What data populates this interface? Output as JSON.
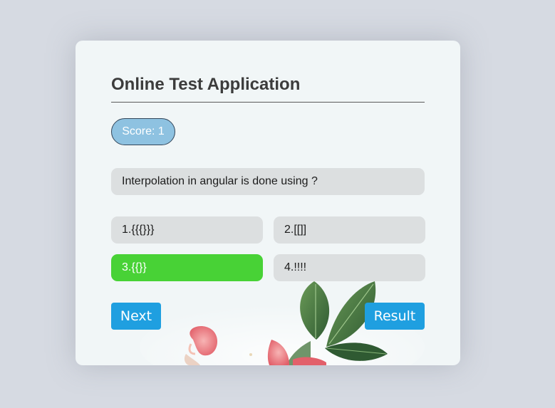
{
  "app": {
    "title": "Online Test Application"
  },
  "score": {
    "label": "Score: 1"
  },
  "question": {
    "text": "Interpolation in angular is done using ?"
  },
  "options": [
    {
      "label": "1.{{{}}}",
      "state": "default"
    },
    {
      "label": "2.[[]]",
      "state": "default"
    },
    {
      "label": "3.{{}}",
      "state": "correct"
    },
    {
      "label": "4.!!!!",
      "state": "default"
    }
  ],
  "buttons": {
    "next": "Next",
    "result": "Result"
  },
  "colors": {
    "background": "#d6dae2",
    "card": "#f1f6f7",
    "score_badge": "#8ec2e1",
    "option_default": "#dcdfe0",
    "option_correct": "#48d236",
    "button": "#1f9fe0"
  },
  "decoration": {
    "icon": "flowers-leaves-background"
  }
}
